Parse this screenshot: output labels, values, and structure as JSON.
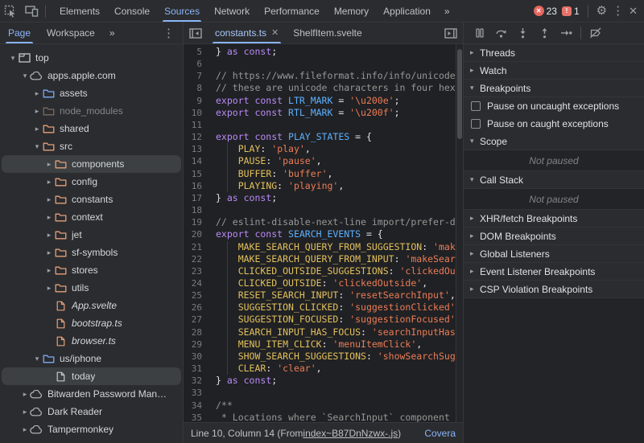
{
  "toolbar": {
    "tabs": [
      "Elements",
      "Console",
      "Sources",
      "Network",
      "Performance",
      "Memory",
      "Application"
    ],
    "active_tab": "Sources",
    "more_label": "»",
    "error_count": "23",
    "issue_count": "1",
    "gear_glyph": "⚙",
    "kebab_glyph": "⋮",
    "close_glyph": "✕"
  },
  "sidebar": {
    "tabs": [
      "Page",
      "Workspace"
    ],
    "active_tab": "Page",
    "more_label": "»",
    "kebab_glyph": "⋮",
    "tree": [
      {
        "label": "top",
        "icon": "frame",
        "color": "plain",
        "arrow": "down",
        "level": 0
      },
      {
        "label": "apps.apple.com",
        "icon": "cloud",
        "color": "plain",
        "arrow": "down",
        "level": 1
      },
      {
        "label": "assets",
        "icon": "folder",
        "color": "blue",
        "arrow": "right",
        "level": 2
      },
      {
        "label": "node_modules",
        "icon": "folder",
        "color": "dim",
        "arrow": "right",
        "level": 2,
        "dim": true
      },
      {
        "label": "shared",
        "icon": "folder",
        "color": "orange",
        "arrow": "right",
        "level": 2
      },
      {
        "label": "src",
        "icon": "folder",
        "color": "orange",
        "arrow": "down",
        "level": 2
      },
      {
        "label": "components",
        "icon": "folder",
        "color": "orange",
        "arrow": "right",
        "level": 3,
        "selected": true
      },
      {
        "label": "config",
        "icon": "folder",
        "color": "orange",
        "arrow": "right",
        "level": 3
      },
      {
        "label": "constants",
        "icon": "folder",
        "color": "orange",
        "arrow": "right",
        "level": 3
      },
      {
        "label": "context",
        "icon": "folder",
        "color": "orange",
        "arrow": "right",
        "level": 3
      },
      {
        "label": "jet",
        "icon": "folder",
        "color": "orange",
        "arrow": "right",
        "level": 3
      },
      {
        "label": "sf-symbols",
        "icon": "folder",
        "color": "orange",
        "arrow": "right",
        "level": 3
      },
      {
        "label": "stores",
        "icon": "folder",
        "color": "orange",
        "arrow": "right",
        "level": 3
      },
      {
        "label": "utils",
        "icon": "folder",
        "color": "orange",
        "arrow": "right",
        "level": 3
      },
      {
        "label": "App.svelte",
        "icon": "file",
        "color": "orange",
        "arrow": "none",
        "level": 3,
        "italic": true
      },
      {
        "label": "bootstrap.ts",
        "icon": "file",
        "color": "orange",
        "arrow": "none",
        "level": 3,
        "italic": true
      },
      {
        "label": "browser.ts",
        "icon": "file",
        "color": "orange",
        "arrow": "none",
        "level": 3,
        "italic": true
      },
      {
        "label": "us/iphone",
        "icon": "folder",
        "color": "blue",
        "arrow": "down",
        "level": 2
      },
      {
        "label": "today",
        "icon": "file",
        "color": "plain",
        "arrow": "none",
        "level": 3,
        "selected": true
      },
      {
        "label": "Bitwarden Password Man…",
        "icon": "cloud",
        "color": "plain",
        "arrow": "right",
        "level": 1
      },
      {
        "label": "Dark Reader",
        "icon": "cloud",
        "color": "plain",
        "arrow": "right",
        "level": 1
      },
      {
        "label": "Tampermonkey",
        "icon": "cloud",
        "color": "plain",
        "arrow": "right",
        "level": 1
      }
    ]
  },
  "editor": {
    "tabs": [
      {
        "label": "constants.ts",
        "active": true,
        "closable": true,
        "close_glyph": "✕"
      },
      {
        "label": "ShelfItem.svelte",
        "active": false,
        "closable": false
      }
    ],
    "code": [
      {
        "n": "5",
        "g": false,
        "tokens": [
          [
            "} ",
            "pl"
          ],
          [
            "as const",
            "kw"
          ],
          [
            ";",
            "pl"
          ]
        ]
      },
      {
        "n": "6",
        "g": false,
        "tokens": []
      },
      {
        "n": "7",
        "g": false,
        "tokens": [
          [
            "// https://www.fileformat.info/info/unicode",
            "cmt"
          ]
        ]
      },
      {
        "n": "8",
        "g": false,
        "tokens": [
          [
            "// these are unicode characters in four hexa",
            "cmt"
          ]
        ]
      },
      {
        "n": "9",
        "g": false,
        "tokens": [
          [
            "export const ",
            "kw"
          ],
          [
            "LTR_MARK",
            "def"
          ],
          [
            " = ",
            "pl"
          ],
          [
            "'\\u200e'",
            "str"
          ],
          [
            ";",
            "pl"
          ]
        ]
      },
      {
        "n": "10",
        "g": false,
        "tokens": [
          [
            "export const ",
            "kw"
          ],
          [
            "RTL_MARK",
            "def"
          ],
          [
            " = ",
            "pl"
          ],
          [
            "'\\u200f'",
            "str"
          ],
          [
            ";",
            "pl"
          ]
        ]
      },
      {
        "n": "11",
        "g": false,
        "tokens": []
      },
      {
        "n": "12",
        "g": false,
        "tokens": [
          [
            "export const ",
            "kw"
          ],
          [
            "PLAY_STATES",
            "def"
          ],
          [
            " = {",
            "pl"
          ]
        ]
      },
      {
        "n": "13",
        "g": true,
        "tokens": [
          [
            "    ",
            "pl"
          ],
          [
            "PLAY",
            "prop"
          ],
          [
            ": ",
            "pl"
          ],
          [
            "'play'",
            "str"
          ],
          [
            ",",
            "pl"
          ]
        ]
      },
      {
        "n": "14",
        "g": true,
        "tokens": [
          [
            "    ",
            "pl"
          ],
          [
            "PAUSE",
            "prop"
          ],
          [
            ": ",
            "pl"
          ],
          [
            "'pause'",
            "str"
          ],
          [
            ",",
            "pl"
          ]
        ]
      },
      {
        "n": "15",
        "g": true,
        "tokens": [
          [
            "    ",
            "pl"
          ],
          [
            "BUFFER",
            "prop"
          ],
          [
            ": ",
            "pl"
          ],
          [
            "'buffer'",
            "str"
          ],
          [
            ",",
            "pl"
          ]
        ]
      },
      {
        "n": "16",
        "g": true,
        "tokens": [
          [
            "    ",
            "pl"
          ],
          [
            "PLAYING",
            "prop"
          ],
          [
            ": ",
            "pl"
          ],
          [
            "'playing'",
            "str"
          ],
          [
            ",",
            "pl"
          ]
        ]
      },
      {
        "n": "17",
        "g": false,
        "tokens": [
          [
            "} ",
            "pl"
          ],
          [
            "as const",
            "kw"
          ],
          [
            ";",
            "pl"
          ]
        ]
      },
      {
        "n": "18",
        "g": false,
        "tokens": []
      },
      {
        "n": "19",
        "g": false,
        "tokens": [
          [
            "// eslint-disable-next-line import/prefer-de",
            "cmt"
          ]
        ]
      },
      {
        "n": "20",
        "g": false,
        "tokens": [
          [
            "export const ",
            "kw"
          ],
          [
            "SEARCH_EVENTS",
            "def"
          ],
          [
            " = {",
            "pl"
          ]
        ]
      },
      {
        "n": "21",
        "g": true,
        "tokens": [
          [
            "    ",
            "pl"
          ],
          [
            "MAKE_SEARCH_QUERY_FROM_SUGGESTION",
            "prop"
          ],
          [
            ": ",
            "pl"
          ],
          [
            "'mak",
            "str"
          ]
        ]
      },
      {
        "n": "22",
        "g": true,
        "tokens": [
          [
            "    ",
            "pl"
          ],
          [
            "MAKE_SEARCH_QUERY_FROM_INPUT",
            "prop"
          ],
          [
            ": ",
            "pl"
          ],
          [
            "'makeSear",
            "str"
          ]
        ]
      },
      {
        "n": "23",
        "g": true,
        "tokens": [
          [
            "    ",
            "pl"
          ],
          [
            "CLICKED_OUTSIDE_SUGGESTIONS",
            "prop"
          ],
          [
            ": ",
            "pl"
          ],
          [
            "'clickedOu",
            "str"
          ]
        ]
      },
      {
        "n": "24",
        "g": true,
        "tokens": [
          [
            "    ",
            "pl"
          ],
          [
            "CLICKED_OUTSIDE",
            "prop"
          ],
          [
            ": ",
            "pl"
          ],
          [
            "'clickedOutside'",
            "str"
          ],
          [
            ",",
            "pl"
          ]
        ]
      },
      {
        "n": "25",
        "g": true,
        "tokens": [
          [
            "    ",
            "pl"
          ],
          [
            "RESET_SEARCH_INPUT",
            "prop"
          ],
          [
            ": ",
            "pl"
          ],
          [
            "'resetSearchInput'",
            "str"
          ],
          [
            ",",
            "pl"
          ]
        ]
      },
      {
        "n": "26",
        "g": true,
        "tokens": [
          [
            "    ",
            "pl"
          ],
          [
            "SUGGESTION_CLICKED",
            "prop"
          ],
          [
            ": ",
            "pl"
          ],
          [
            "'suggestionClicked'",
            "str"
          ]
        ]
      },
      {
        "n": "27",
        "g": true,
        "tokens": [
          [
            "    ",
            "pl"
          ],
          [
            "SUGGESTION_FOCUSED",
            "prop"
          ],
          [
            ": ",
            "pl"
          ],
          [
            "'suggestionFocused'",
            "str"
          ]
        ]
      },
      {
        "n": "28",
        "g": true,
        "tokens": [
          [
            "    ",
            "pl"
          ],
          [
            "SEARCH_INPUT_HAS_FOCUS",
            "prop"
          ],
          [
            ": ",
            "pl"
          ],
          [
            "'searchInputHas",
            "str"
          ]
        ]
      },
      {
        "n": "29",
        "g": true,
        "tokens": [
          [
            "    ",
            "pl"
          ],
          [
            "MENU_ITEM_CLICK",
            "prop"
          ],
          [
            ": ",
            "pl"
          ],
          [
            "'menuItemClick'",
            "str"
          ],
          [
            ",",
            "pl"
          ]
        ]
      },
      {
        "n": "30",
        "g": true,
        "tokens": [
          [
            "    ",
            "pl"
          ],
          [
            "SHOW_SEARCH_SUGGESTIONS",
            "prop"
          ],
          [
            ": ",
            "pl"
          ],
          [
            "'showSearchSug",
            "str"
          ]
        ]
      },
      {
        "n": "31",
        "g": true,
        "tokens": [
          [
            "    ",
            "pl"
          ],
          [
            "CLEAR",
            "prop"
          ],
          [
            ": ",
            "pl"
          ],
          [
            "'clear'",
            "str"
          ],
          [
            ",",
            "pl"
          ]
        ]
      },
      {
        "n": "32",
        "g": false,
        "tokens": [
          [
            "} ",
            "pl"
          ],
          [
            "as const",
            "kw"
          ],
          [
            ";",
            "pl"
          ]
        ]
      },
      {
        "n": "33",
        "g": false,
        "tokens": []
      },
      {
        "n": "34",
        "g": false,
        "tokens": [
          [
            "/**",
            "cmt"
          ]
        ]
      },
      {
        "n": "35",
        "g": false,
        "tokens": [
          [
            " * Locations where `SearchInput` component",
            "cmt"
          ]
        ]
      }
    ],
    "status": {
      "left_prefix": "Line 10, Column 14 (From ",
      "link": "index~B87DnNzwx-.js",
      "left_suffix": ")",
      "right": "Covera"
    }
  },
  "debugger": {
    "sections": [
      {
        "type": "header",
        "label": "Threads",
        "arrow": "right"
      },
      {
        "type": "header",
        "label": "Watch",
        "arrow": "right"
      },
      {
        "type": "header",
        "label": "Breakpoints",
        "arrow": "down"
      },
      {
        "type": "checkbox",
        "label": "Pause on uncaught exceptions"
      },
      {
        "type": "checkbox",
        "label": "Pause on caught exceptions"
      },
      {
        "type": "header",
        "label": "Scope",
        "arrow": "down"
      },
      {
        "type": "empty",
        "label": "Not paused"
      },
      {
        "type": "header",
        "label": "Call Stack",
        "arrow": "down"
      },
      {
        "type": "empty",
        "label": "Not paused"
      },
      {
        "type": "header",
        "label": "XHR/fetch Breakpoints",
        "arrow": "right"
      },
      {
        "type": "header",
        "label": "DOM Breakpoints",
        "arrow": "right"
      },
      {
        "type": "header",
        "label": "Global Listeners",
        "arrow": "right"
      },
      {
        "type": "header",
        "label": "Event Listener Breakpoints",
        "arrow": "right"
      },
      {
        "type": "header",
        "label": "CSP Violation Breakpoints",
        "arrow": "right"
      }
    ]
  },
  "colors": {
    "accent_blue": "#8ab4f8",
    "error_red": "#e5675f",
    "folder_orange": "#e5a07a",
    "folder_blue": "#7cacf8",
    "folder_dim": "#7a6a5f",
    "file_plain": "#c6c8ca",
    "icon_gray": "#9aa0a6",
    "code_keyword": "#b98af7",
    "code_definition": "#5db0ff",
    "code_property": "#e2c05c",
    "code_string": "#ec7d56",
    "code_comment": "#969896"
  }
}
